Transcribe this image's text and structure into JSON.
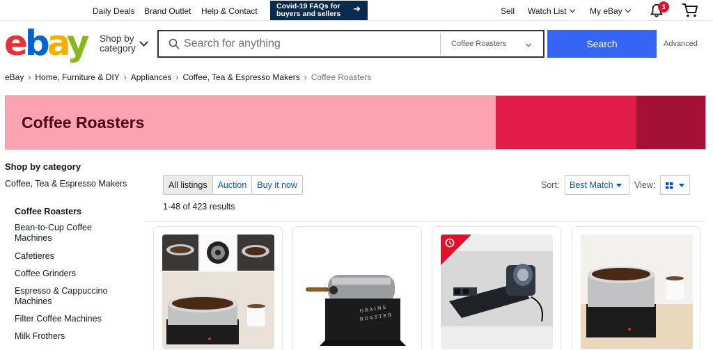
{
  "topbar": {
    "links": [
      "Daily Deals",
      "Brand Outlet",
      "Help & Contact"
    ],
    "covid_banner": "Covid-19 FAQs for buyers and sellers",
    "sell": "Sell",
    "watch_list": "Watch List",
    "my_ebay": "My eBay",
    "notification_count": "3"
  },
  "header": {
    "logo": {
      "e": "e",
      "b": "b",
      "a": "a",
      "y": "y"
    },
    "shop_by_category": "Shop by category",
    "search_placeholder": "Search for anything",
    "category_select": "Coffee Roasters",
    "search_button": "Search",
    "advanced": "Advanced"
  },
  "breadcrumb": [
    "eBay",
    "Home, Furniture & DIY",
    "Appliances",
    "Coffee, Tea & Espresso Makers",
    "Coffee Roasters"
  ],
  "banner": {
    "title": "Coffee Roasters",
    "colors": [
      "#fca3b2",
      "#e21c48",
      "#a51134"
    ]
  },
  "sidebar": {
    "heading": "Shop by category",
    "parent": "Coffee, Tea & Espresso Makers",
    "items": [
      {
        "label": "Coffee Roasters",
        "active": true
      },
      {
        "label": "Bean-to-Cup Coffee Machines"
      },
      {
        "label": "Cafetieres"
      },
      {
        "label": "Coffee Grinders"
      },
      {
        "label": "Espresso & Cappuccino Machines"
      },
      {
        "label": "Filter Coffee Machines"
      },
      {
        "label": "Milk Frothers"
      }
    ]
  },
  "listing": {
    "tabs": [
      "All listings",
      "Auction",
      "Buy it now"
    ],
    "sort_label": "Sort:",
    "sort_value": "Best Match",
    "view_label": "View:",
    "results": "1-48 of 423 results"
  },
  "products": [
    {
      "image": "home-roaster-bowl-collage"
    },
    {
      "image": "grains-roaster-drum"
    },
    {
      "image": "digital-drum-roaster",
      "deal_badge": "clock-icon"
    },
    {
      "image": "home-roaster-bowl"
    }
  ],
  "colors": {
    "accent": "#3665f3",
    "link": "#0654ba",
    "covid_bg": "#0a2b4d",
    "badge": "#e0102a"
  }
}
